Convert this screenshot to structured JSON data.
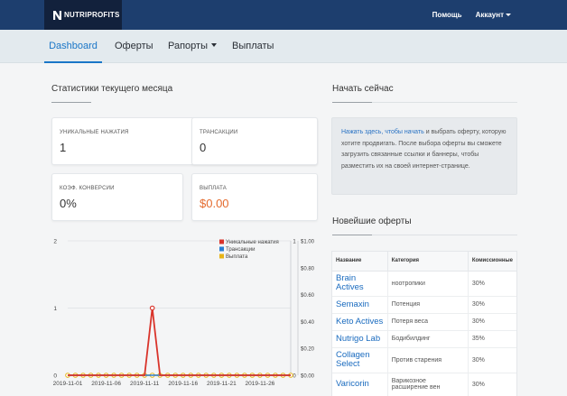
{
  "brand": {
    "name": "NUTRIPROFITS",
    "icon": "logo-n-icon"
  },
  "topbar": {
    "help": "Помощь",
    "account": "Аккаунт"
  },
  "nav": {
    "dashboard": "Dashboard",
    "offers": "Оферты",
    "reports": "Рапорты",
    "payouts": "Выплаты"
  },
  "stats": {
    "title": "Статистики текущего месяца",
    "unique_clicks": {
      "label": "Уникальные нажатия",
      "value": "1"
    },
    "transactions": {
      "label": "Трансакции",
      "value": "0"
    },
    "conversion": {
      "label": "Коэф. конверсии",
      "value": "0%"
    },
    "payout": {
      "label": "Выплата",
      "value": "$0.00"
    }
  },
  "start": {
    "title": "Начать сейчас",
    "link": "Нажать здесь, чтобы начать",
    "text": " и выбрать оферту, которую хотите продвигать. После выбора оферты вы сможете загрузить связанные ссылки и баннеры, чтобы разместить их на своей интернет-странице."
  },
  "newest": {
    "title": "Новейшие оферты",
    "headers": [
      "Название",
      "Категория",
      "Комиссионные"
    ],
    "rows": [
      [
        "Brain Actives",
        "ноотропики",
        "30%"
      ],
      [
        "Semaxin",
        "Потенция",
        "30%"
      ],
      [
        "Keto Actives",
        "Потеря веса",
        "30%"
      ],
      [
        "Nutrigo Lab",
        "Бодибилдинг",
        "35%"
      ],
      [
        "Collagen Select",
        "Против старения",
        "30%"
      ],
      [
        "Varicorin",
        "Варикозное расширение вен",
        "30%"
      ]
    ]
  },
  "chart_data": {
    "type": "line",
    "x": [
      "2019-11-01",
      "2019-11-02",
      "2019-11-03",
      "2019-11-04",
      "2019-11-05",
      "2019-11-06",
      "2019-11-07",
      "2019-11-08",
      "2019-11-09",
      "2019-11-10",
      "2019-11-11",
      "2019-11-12",
      "2019-11-13",
      "2019-11-14",
      "2019-11-15",
      "2019-11-16",
      "2019-11-17",
      "2019-11-18",
      "2019-11-19",
      "2019-11-20",
      "2019-11-21",
      "2019-11-22",
      "2019-11-23",
      "2019-11-24",
      "2019-11-25",
      "2019-11-26",
      "2019-11-27",
      "2019-11-28",
      "2019-11-29",
      "2019-11-30"
    ],
    "x_ticks": [
      "2019-11-01",
      "2019-11-06",
      "2019-11-11",
      "2019-11-16",
      "2019-11-21",
      "2019-11-26"
    ],
    "y_left_ticks": [
      0,
      1,
      2
    ],
    "y_right_ticks": [
      "$0.00",
      "$0.20",
      "$0.40",
      "$0.60",
      "$0.80",
      "$1.00"
    ],
    "y_right_inner_ticks": [
      "0",
      "1"
    ],
    "ylim": [
      0,
      2
    ],
    "y2lim": [
      0,
      1
    ],
    "legend_position": "top-right",
    "series": [
      {
        "name": "Уникальные нажатия",
        "color": "#d9342b",
        "values": [
          0,
          0,
          0,
          0,
          0,
          0,
          0,
          0,
          0,
          0,
          0,
          1,
          0,
          0,
          0,
          0,
          0,
          0,
          0,
          0,
          0,
          0,
          0,
          0,
          0,
          0,
          0,
          0,
          0,
          0
        ]
      },
      {
        "name": "Трансакции",
        "color": "#2a7fd4",
        "values": [
          0,
          0,
          0,
          0,
          0,
          0,
          0,
          0,
          0,
          0,
          0,
          0,
          0,
          0,
          0,
          0,
          0,
          0,
          0,
          0,
          0,
          0,
          0,
          0,
          0,
          0,
          0,
          0,
          0,
          0
        ]
      },
      {
        "name": "Выплата",
        "color": "#e7b416",
        "values": [
          0,
          0,
          0,
          0,
          0,
          0,
          0,
          0,
          0,
          0,
          0,
          0,
          0,
          0,
          0,
          0,
          0,
          0,
          0,
          0,
          0,
          0,
          0,
          0,
          0,
          0,
          0,
          0,
          0,
          0
        ]
      }
    ]
  }
}
